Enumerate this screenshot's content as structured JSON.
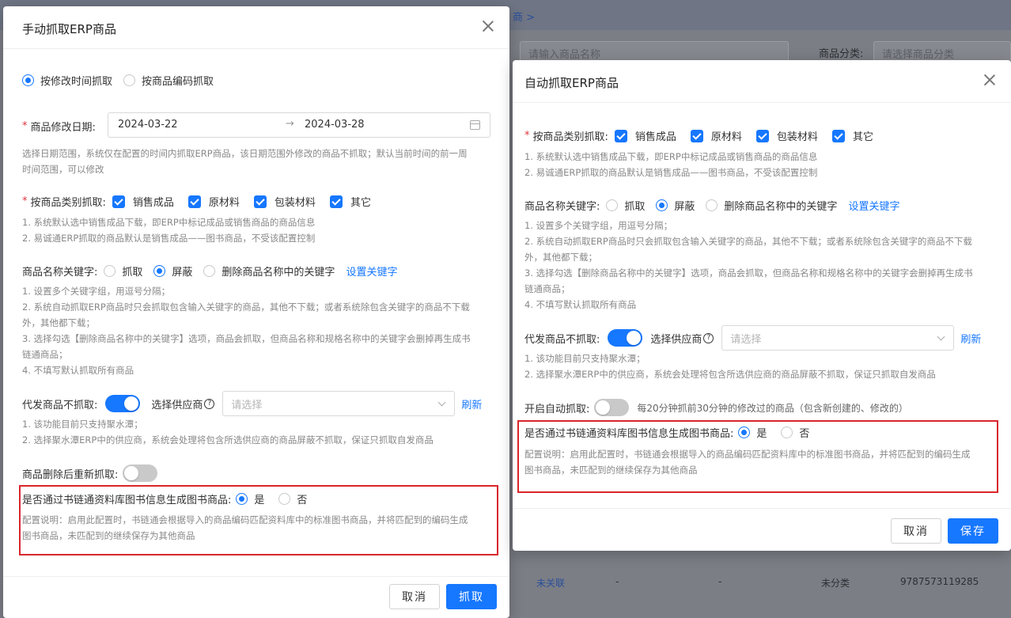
{
  "background": {
    "breadcrumb": "商 >",
    "search_placeholder": "请输入商品名称",
    "category_label": "商品分类:",
    "category_placeholder": "请选择商品分类",
    "row": {
      "link": "未关联",
      "c1": "-",
      "c2": "-",
      "category": "未分类",
      "isbn": "9787573119285"
    }
  },
  "left": {
    "title": "手动抓取ERP商品",
    "mode_options": [
      "按修改时间抓取",
      "按商品编码抓取"
    ],
    "date_label": "商品修改日期:",
    "date_start": "2024-03-22",
    "date_end": "2024-03-28",
    "date_sep": "→",
    "date_hint_1": "选择日期范围，系统仅在配置的时间内抓取ERP商品，该日期范围外修改的商品不抓取；默认当前时间的前一周",
    "date_hint_2": "时间范围，可以修改",
    "category_label": "按商品类别抓取:",
    "categories": [
      "销售成品",
      "原材料",
      "包装材料",
      "其它"
    ],
    "category_hint_1": "1. 系统默认选中销售成品下载，即ERP中标记成品或销售商品的商品信息",
    "category_hint_2": "2. 易诚通ERP抓取的商品默认是销售成品——图书商品，不受该配置控制",
    "keyword_label": "商品名称关键字:",
    "keyword_options": [
      "抓取",
      "屏蔽",
      "删除商品名称中的关键字"
    ],
    "keyword_link": "设置关键字",
    "keyword_hints": [
      "1. 设置多个关键字组，用逗号分隔；",
      "2. 系统自动抓取ERP商品时只会抓取包含输入关键字的商品，其他不下载；或者系统除包含关键字的商品不下载",
      "外，其他都下载；",
      "3. 选择勾选【删除商品名称中的关键字】选项，商品会抓取，但商品名称和规格名称中的关键字会删掉再生成书",
      "链通商品；",
      "4. 不填写默认抓取所有商品"
    ],
    "dropship_label": "代发商品不抓取:",
    "supplier_label": "选择供应商",
    "supplier_placeholder": "请选择",
    "refresh": "刷新",
    "dropship_hint_1": "1. 该功能目前只支持聚水潭；",
    "dropship_hint_2": "2. 选择聚水潭ERP中的供应商，系统会处理将包含所选供应商的商品屏蔽不抓取，保证只抓取自发商品",
    "refetch_label": "商品删除后重新抓取:",
    "book_label": "是否通过书链通资料库图书信息生成图书商品:",
    "yes": "是",
    "no": "否",
    "book_hint_1": "配置说明：启用此配置时，书链通会根据导入的商品编码匹配资料库中的标准图书商品，并将匹配到的编码生成",
    "book_hint_2": "图书商品，未匹配到的继续保存为其他商品",
    "cancel": "取消",
    "confirm": "抓取"
  },
  "right": {
    "title": "自动抓取ERP商品",
    "category_label": "按商品类别抓取:",
    "categories": [
      "销售成品",
      "原材料",
      "包装材料",
      "其它"
    ],
    "category_hint_1": "1. 系统默认选中销售成品下载，即ERP中标记成品或销售商品的商品信息",
    "category_hint_2": "2. 易诚通ERP抓取的商品默认是销售成品——图书商品，不受该配置控制",
    "keyword_label": "商品名称关键字:",
    "keyword_options": [
      "抓取",
      "屏蔽",
      "删除商品名称中的关键字"
    ],
    "keyword_link": "设置关键字",
    "keyword_hints": [
      "1. 设置多个关键字组，用逗号分隔；",
      "2. 系统自动抓取ERP商品时只会抓取包含输入关键字的商品，其他不下载；或者系统除包含关键字的商品不下载",
      "外，其他都下载；",
      "3. 选择勾选【删除商品名称中的关键字】选项，商品会抓取，但商品名称和规格名称中的关键字会删掉再生成书",
      "链通商品；",
      "4. 不填写默认抓取所有商品"
    ],
    "dropship_label": "代发商品不抓取:",
    "supplier_label": "选择供应商",
    "supplier_placeholder": "请选择",
    "refresh": "刷新",
    "dropship_hint_1": "1. 该功能目前只支持聚水潭；",
    "dropship_hint_2": "2. 选择聚水潭ERP中的供应商，系统会处理将包含所选供应商的商品屏蔽不抓取，保证只抓取自发商品",
    "auto_label": "开启自动抓取:",
    "auto_desc": "每20分钟抓前30分钟的修改过的商品（包含新创建的、修改的）",
    "book_label": "是否通过书链通资料库图书信息生成图书商品:",
    "yes": "是",
    "no": "否",
    "book_hint_1": "配置说明：启用此配置时，书链通会根据导入的商品编码匹配资料库中的标准图书商品，并将匹配到的编码生成",
    "book_hint_2": "图书商品，未匹配到的继续保存为其他商品",
    "cancel": "取消",
    "confirm": "保存"
  }
}
